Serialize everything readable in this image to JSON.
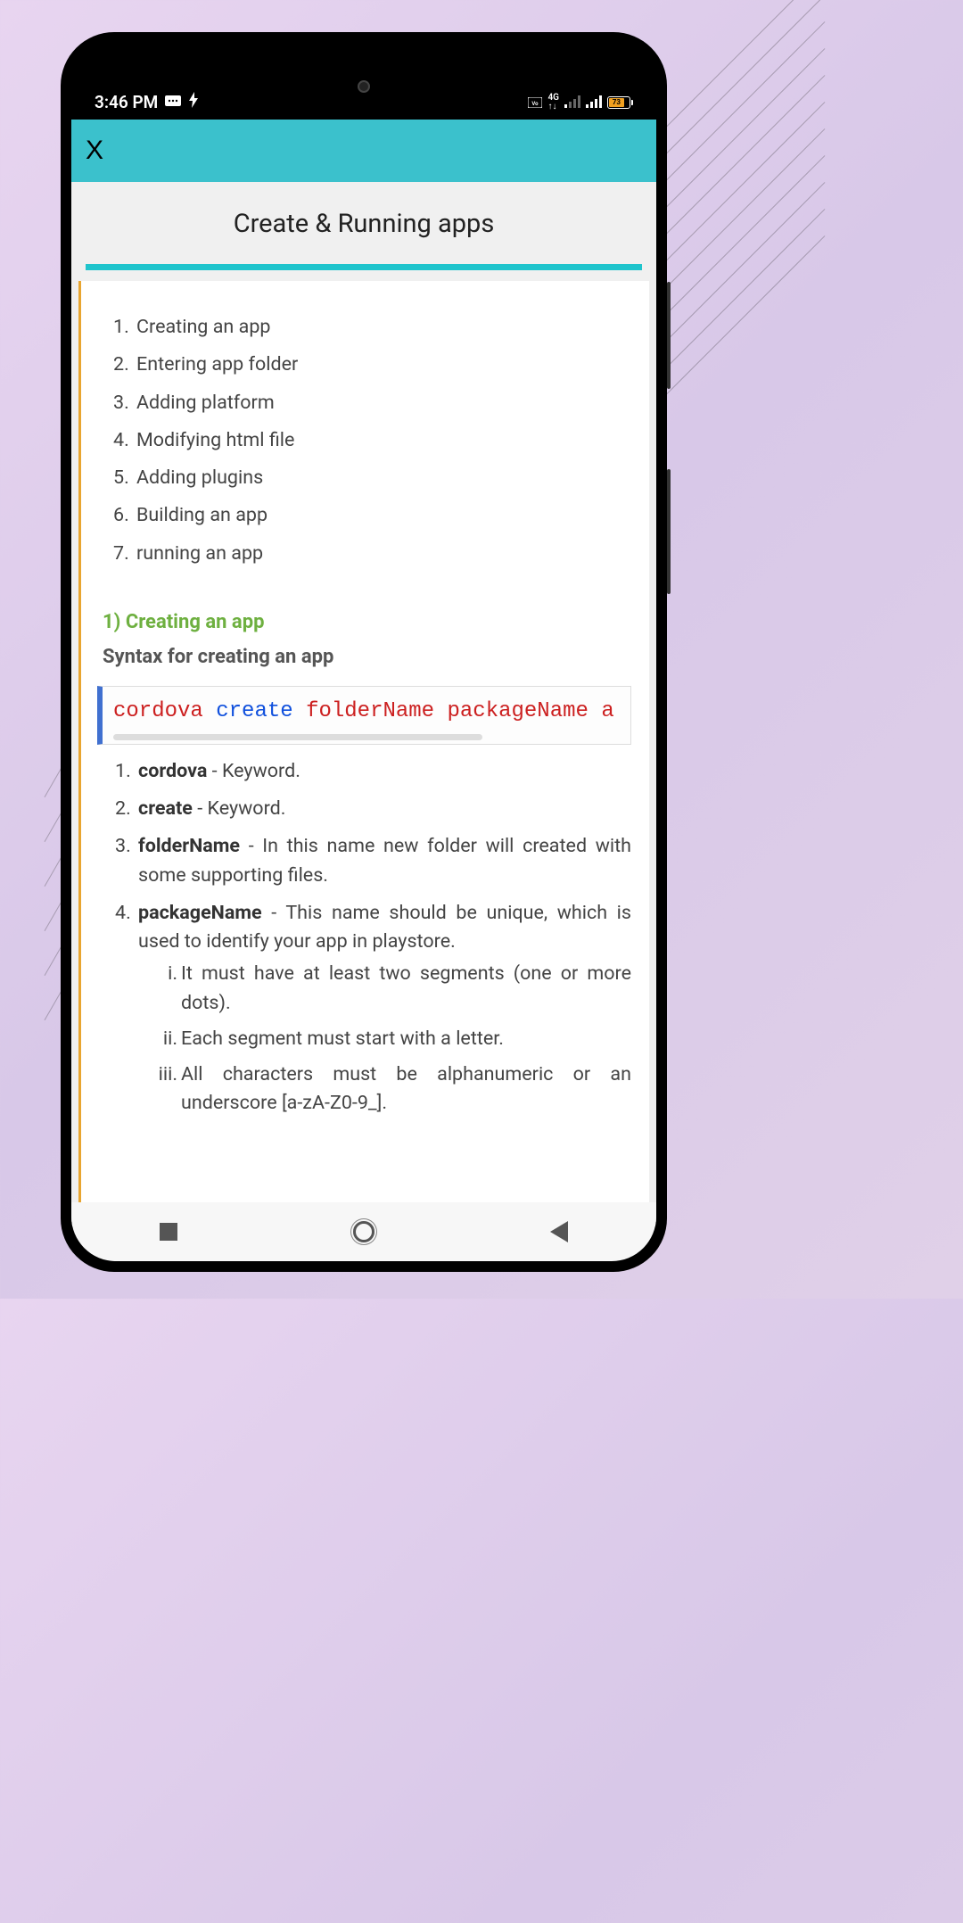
{
  "status": {
    "time": "3:46 PM",
    "battery_pct": "73"
  },
  "header": {
    "close": "X"
  },
  "page_title": "Create & Running apps",
  "toc": [
    "Creating an app",
    "Entering app folder",
    "Adding platform",
    "Modifying html file",
    "Adding plugins",
    "Building an app",
    "running an app"
  ],
  "section": {
    "heading": "1) Creating an app",
    "syntax_label": "Syntax for creating an app",
    "code": {
      "p1": "cordova",
      "p2": "create",
      "p3": "folderName packageName a"
    }
  },
  "defs": {
    "d1_b": "cordova",
    "d1_t": " - Keyword.",
    "d2_b": "create",
    "d2_t": " - Keyword.",
    "d3_b": "folderName",
    "d3_t": " - In this name new folder will created with some supporting files.",
    "d4_b": "packageName",
    "d4_t": " - This name should be unique, which is used to identify your app in playstore.",
    "sub": [
      "It must have at least two segments (one or more dots).",
      "Each segment must start with a letter.",
      "All characters must be alphanumeric or an underscore [a-zA-Z0-9_]."
    ]
  }
}
